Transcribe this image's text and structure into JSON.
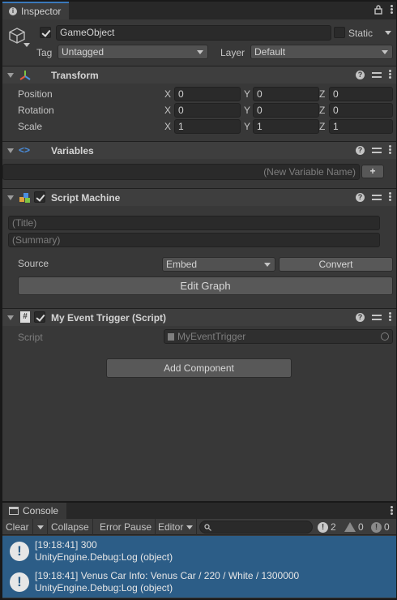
{
  "inspector": {
    "tab_label": "Inspector",
    "icons": {
      "tab": "info-icon",
      "lock": "lock-icon",
      "menu": "kebab-menu-icon"
    },
    "gameobject": {
      "enabled": true,
      "name": "GameObject",
      "static_label": "Static",
      "static_checked": false,
      "tag_label": "Tag",
      "tag_value": "Untagged",
      "layer_label": "Layer",
      "layer_value": "Default"
    },
    "transform": {
      "title": "Transform",
      "rows": [
        {
          "label": "Position",
          "x": "0",
          "y": "0",
          "z": "0"
        },
        {
          "label": "Rotation",
          "x": "0",
          "y": "0",
          "z": "0"
        },
        {
          "label": "Scale",
          "x": "1",
          "y": "1",
          "z": "1"
        }
      ],
      "axis": {
        "x": "X",
        "y": "Y",
        "z": "Z"
      }
    },
    "variables": {
      "title": "Variables",
      "new_variable_placeholder": "(New Variable Name)",
      "add_label": "+"
    },
    "script_machine": {
      "title": "Script Machine",
      "enabled": true,
      "title_placeholder": "(Title)",
      "summary_placeholder": "(Summary)",
      "source_label": "Source",
      "source_value": "Embed",
      "convert_label": "Convert",
      "edit_graph_label": "Edit Graph"
    },
    "event_trigger": {
      "title": "My Event Trigger (Script)",
      "enabled": true,
      "script_label": "Script",
      "script_value": "MyEventTrigger"
    },
    "add_component_label": "Add Component"
  },
  "console": {
    "tab_label": "Console",
    "toolbar": {
      "clear": "Clear",
      "collapse": "Collapse",
      "error_pause": "Error Pause",
      "editor": "Editor",
      "info_count": "2",
      "warning_count": "0",
      "error_count": "0"
    },
    "logs": [
      {
        "line1": "[19:18:41] 300",
        "line2": "UnityEngine.Debug:Log (object)"
      },
      {
        "line1": "[19:18:41] Venus Car Info: Venus Car / 220 / White / 1300000",
        "line2": "UnityEngine.Debug:Log (object)"
      }
    ]
  },
  "colors": {
    "panel_bg": "#383838",
    "accent_tab": "#3a79bb",
    "log_selected": "#2c5d87"
  }
}
